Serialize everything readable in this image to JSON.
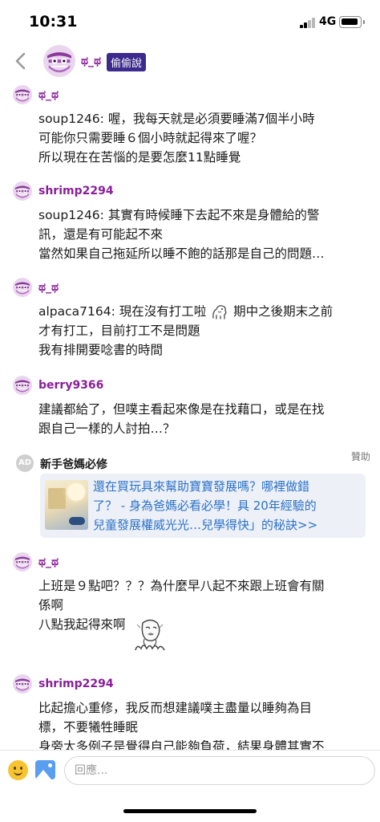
{
  "status_bar": {
    "time": "10:31",
    "network": "4G"
  },
  "header": {
    "name": "ಥ_ಥ",
    "badge": "偷偷說"
  },
  "comments": [
    {
      "name": "ಥ_ಥ",
      "lines": [
        "soup1246: 喔，我每天就是必須要睡滿7個半小時",
        "可能你只需要睡６個小時就起得來了喔？",
        "所以現在在苦惱的是要怎麼11點睡覺"
      ]
    },
    {
      "name": "shrimp2294",
      "lines": [
        "soup1246: 其實有時候睡下去起不來是身體給的警",
        "訊，還是有可能起不來",
        "當然如果自己拖延所以睡不飽的話那是自己的問題…"
      ]
    },
    {
      "name": "ಥ_ಥ",
      "lines": [
        "alpaca7164: 現在沒有打工啦",
        "期中之後期末之前",
        "才有打工，目前打工不是問題",
        "我有排開要唸書的時間"
      ]
    },
    {
      "name": "berry9366",
      "lines": [
        "建議都給了，但噗主看起來像是在找藉口，或是在找",
        "跟自己一樣的人討拍…？"
      ]
    },
    {
      "name": "ಥ_ಥ",
      "lines": [
        "上班是９點吧？？？為什麼早八起不來跟上班會有關",
        "係啊",
        "八點我起得來啊"
      ]
    },
    {
      "name": "shrimp2294",
      "lines": [
        "比起擔心重修，我反而想建議噗主盡量以睡夠為目",
        "標，不要犧牲睡眠",
        "身旁太多例子是覺得自己能夠負荷，結果身體其實不"
      ]
    }
  ],
  "ad": {
    "icon_label": "AD",
    "title": "新手爸媽必修",
    "sponsor_label": "贊助",
    "link_lines": [
      "還在買玩具來幫助寶寶發展嗎？哪裡做錯",
      "了？ - 身為爸媽必看必學！具 20年經驗的",
      "兒童發展權威光光…兒學得快」的秘訣>>"
    ]
  },
  "input": {
    "placeholder": "回應..."
  },
  "icons": {
    "back": "chevron-left-icon",
    "emoji": "smiley-icon",
    "image": "image-icon",
    "signal": "cellular-signal-icon",
    "battery": "battery-icon"
  },
  "colors": {
    "username": "#8a1e9a",
    "badge_bg": "#3c2a8d",
    "link": "#2b72c8",
    "ad_card_bg": "#edf0f7"
  }
}
